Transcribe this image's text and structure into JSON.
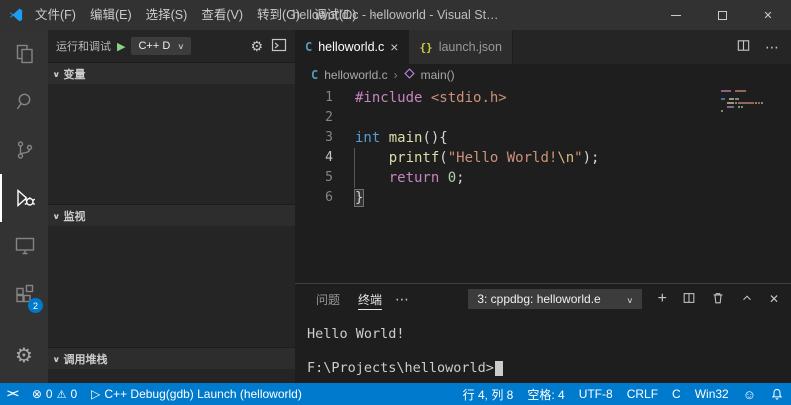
{
  "window": {
    "title": "helloworld.c - helloworld - Visual St…"
  },
  "menu_bar": {
    "items": [
      "文件(F)",
      "编辑(E)",
      "选择(S)",
      "查看(V)",
      "转到(G)",
      "调试(D)"
    ]
  },
  "activity_bar": {
    "extensions_badge": "2"
  },
  "sidebar": {
    "title": "运行和调试",
    "launch_config": "C++ D",
    "sections": {
      "variables": "变量",
      "watch": "监视",
      "call_stack": "调用堆栈"
    }
  },
  "editor": {
    "tabs": [
      {
        "icon": "C",
        "label": "helloworld.c"
      },
      {
        "icon": "{}",
        "label": "launch.json"
      }
    ],
    "breadcrumb": {
      "file": "helloworld.c",
      "symbol": "main()"
    },
    "line_numbers": [
      "1",
      "2",
      "3",
      "4",
      "5",
      "6"
    ],
    "active_line": "4",
    "code": [
      [
        {
          "t": "#include",
          "c": "kw"
        },
        {
          "t": " ",
          "c": "plain"
        },
        {
          "t": "<stdio.h>",
          "c": "str"
        }
      ],
      [],
      [
        {
          "t": "int",
          "c": "type"
        },
        {
          "t": " ",
          "c": "plain"
        },
        {
          "t": "main",
          "c": "fn"
        },
        {
          "t": "(){",
          "c": "plain"
        }
      ],
      [
        {
          "t": "    ",
          "c": "plain"
        },
        {
          "t": "printf",
          "c": "fn"
        },
        {
          "t": "(",
          "c": "plain"
        },
        {
          "t": "\"Hello World!",
          "c": "str"
        },
        {
          "t": "\\n",
          "c": "esc"
        },
        {
          "t": "\"",
          "c": "str"
        },
        {
          "t": ");",
          "c": "plain"
        }
      ],
      [
        {
          "t": "    ",
          "c": "plain"
        },
        {
          "t": "return",
          "c": "kw"
        },
        {
          "t": " ",
          "c": "plain"
        },
        {
          "t": "0",
          "c": "num"
        },
        {
          "t": ";",
          "c": "plain"
        }
      ],
      [
        {
          "t": "}",
          "c": "plain"
        }
      ]
    ]
  },
  "panel": {
    "tabs": {
      "problems": "问题",
      "terminal": "终端"
    },
    "terminal_picker": "3: cppdbg: helloworld.e",
    "terminal_lines": [
      "Hello World!",
      "",
      "F:\\Projects\\helloworld>"
    ]
  },
  "status_bar": {
    "errors": "0",
    "warnings": "0",
    "debug_launch": "C++ Debug(gdb) Launch (helloworld)",
    "cursor_position": "行 4, 列 8",
    "indent": "空格: 4",
    "encoding": "UTF-8",
    "eol": "CRLF",
    "language": "C",
    "platform": "Win32"
  },
  "colors": {
    "status_bar": "#007acc",
    "badge": "#007acc",
    "keyword": "#c586c0",
    "string": "#ce9178",
    "escape": "#d7ba7d",
    "type": "#569cd6",
    "function": "#dcdcaa",
    "number": "#b5cea8"
  }
}
